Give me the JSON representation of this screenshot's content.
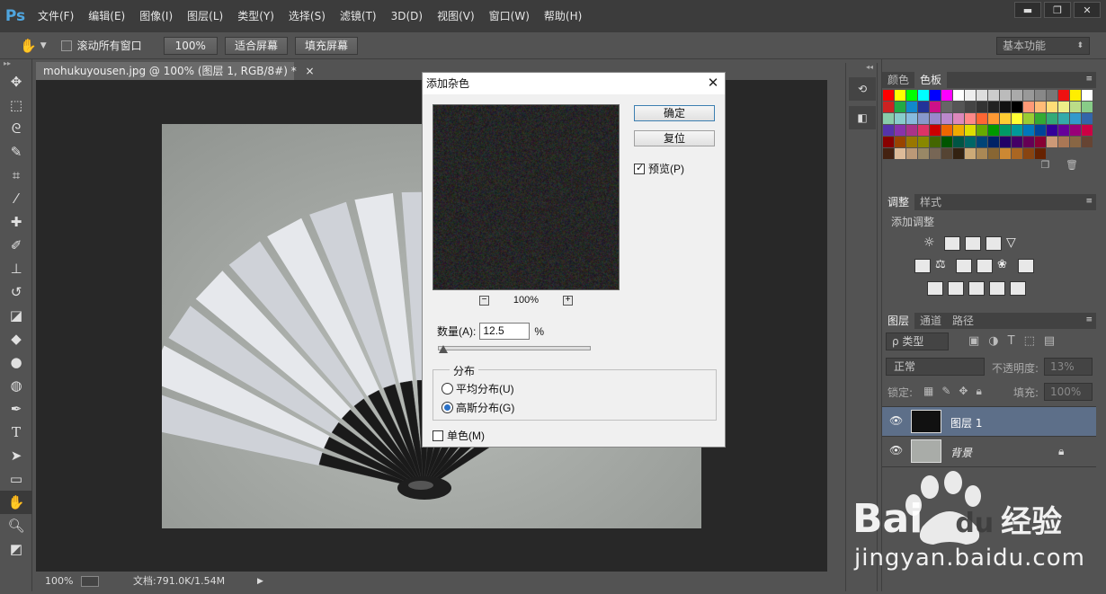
{
  "app": {
    "logo": "Ps"
  },
  "menu": [
    "文件(F)",
    "编辑(E)",
    "图像(I)",
    "图层(L)",
    "类型(Y)",
    "选择(S)",
    "滤镜(T)",
    "3D(D)",
    "视图(V)",
    "窗口(W)",
    "帮助(H)"
  ],
  "window_controls": {
    "minimize": "▬",
    "restore": "❐",
    "close": "✕"
  },
  "options_bar": {
    "scroll_all_label": "滚动所有窗口",
    "zoom_100": "100%",
    "fit_screen": "适合屏幕",
    "fill_screen": "填充屏幕",
    "workspace": "基本功能"
  },
  "document": {
    "tab_title": "mohukuyousen.jpg @ 100% (图层 1, RGB/8#) *",
    "tab_close": "×"
  },
  "status": {
    "zoom": "100%",
    "doc_info": "文档:791.0K/1.54M"
  },
  "panels": {
    "color_tabs": [
      "颜色",
      "色板"
    ],
    "adjust_tabs": [
      "调整",
      "样式"
    ],
    "add_adjustment": "添加调整",
    "layers_tabs": [
      "图层",
      "通道",
      "路径"
    ],
    "filter_kind": "ρ 类型",
    "blend_mode": "正常",
    "opacity_label": "不透明度:",
    "opacity_value": "13%",
    "lock_label": "锁定:",
    "fill_label": "填充:",
    "fill_value": "100%",
    "layers": [
      {
        "name": "图层 1",
        "selected": true
      },
      {
        "name": "背景",
        "selected": false,
        "locked": true
      }
    ]
  },
  "dialog": {
    "title": "添加杂色",
    "close": "✕",
    "ok": "确定",
    "reset": "复位",
    "preview_label": "预览(P)",
    "preview_checked": true,
    "zoom_out": "−",
    "zoom_level": "100%",
    "zoom_in": "+",
    "amount_label": "数量(A):",
    "amount_value": "12.5",
    "amount_unit": "%",
    "amount_fraction": 0.031,
    "distribution_legend": "分布",
    "uniform_label": "平均分布(U)",
    "gaussian_label": "高斯分布(G)",
    "selected_distribution": "gaussian",
    "mono_label": "单色(M)",
    "mono_checked": false
  },
  "watermark": {
    "brand": "Bai",
    "brand_du": "du",
    "brand_suffix": "经验",
    "url": "jingyan.baidu.com"
  },
  "colors": {
    "accent": "#2b72c8",
    "layer_selected": "#5d6f89",
    "dark_bg": "#282828"
  }
}
